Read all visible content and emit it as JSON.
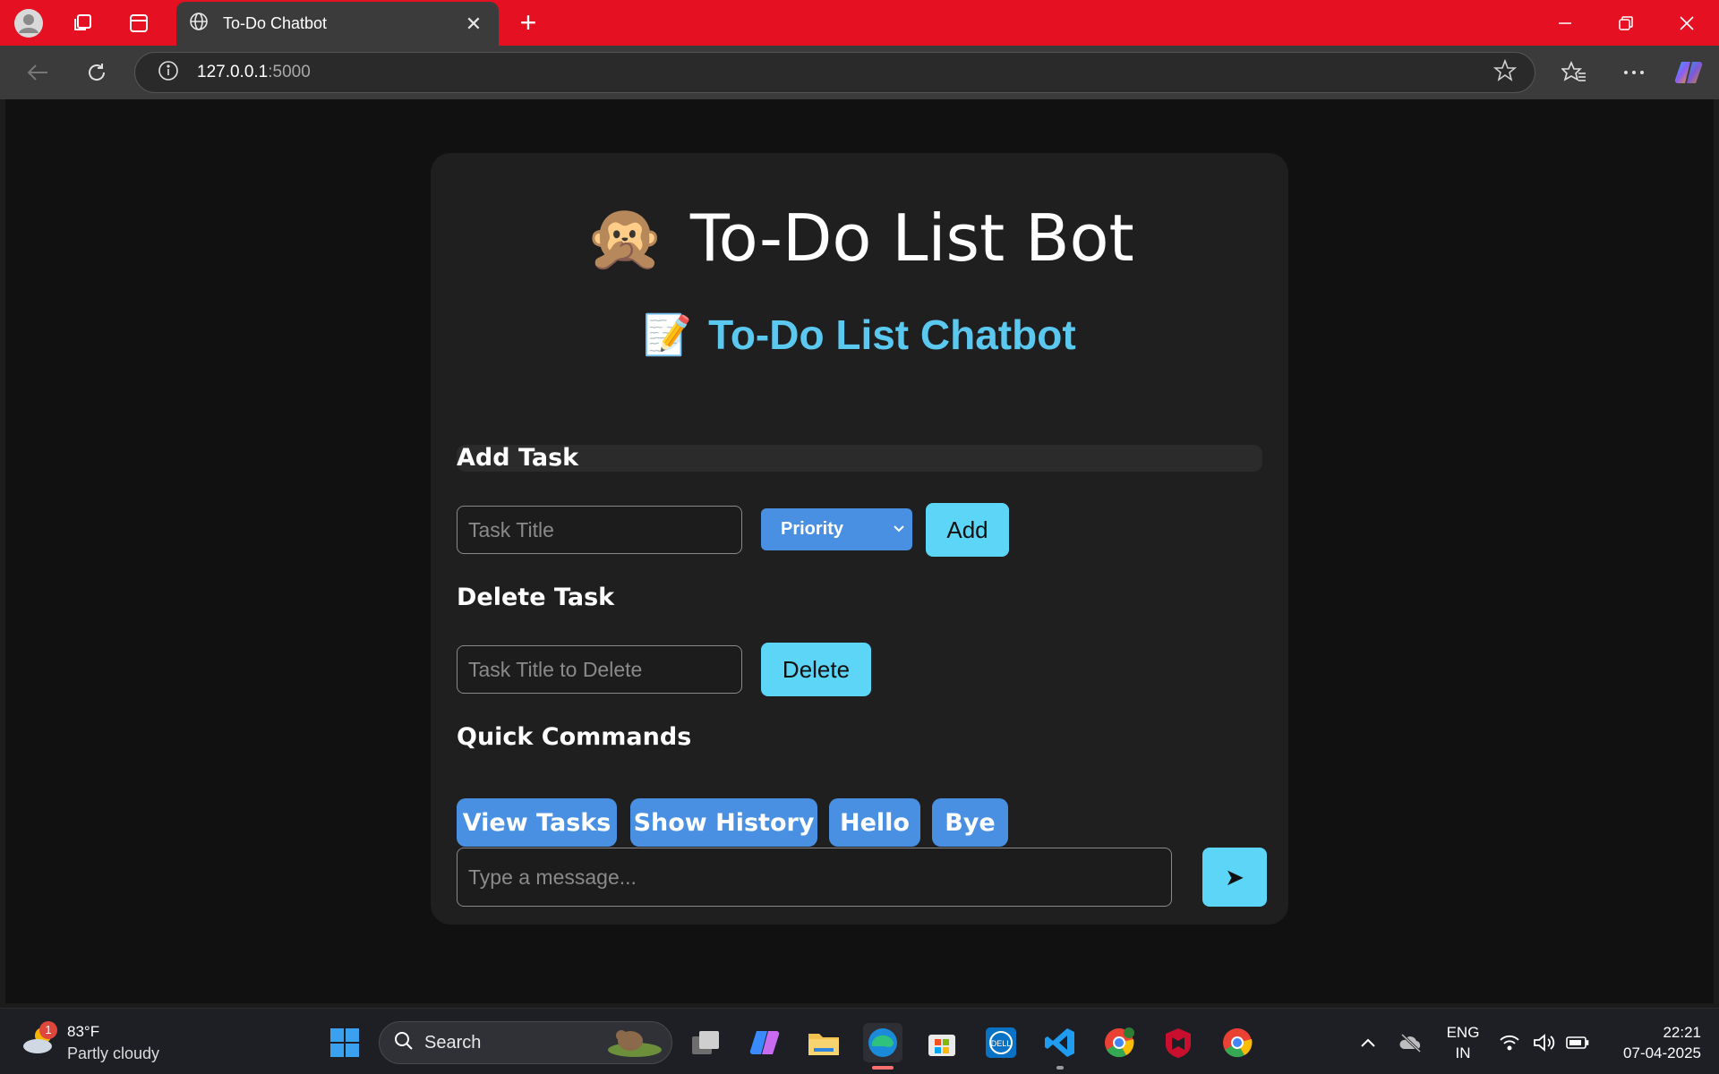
{
  "browser": {
    "tab_title": "To-Do Chatbot",
    "url_host": "127.0.0.1",
    "url_port": ":5000"
  },
  "app": {
    "title_emoji": "🙊",
    "title": "To-Do List Bot",
    "subtitle_emoji": "📝",
    "subtitle": "To-Do List Chatbot",
    "add_task": {
      "heading": "Add Task",
      "input_placeholder": "Task Title",
      "priority_label": "Priority",
      "button_label": "Add"
    },
    "delete_task": {
      "heading": "Delete Task",
      "input_placeholder": "Task Title to Delete",
      "button_label": "Delete"
    },
    "quick_commands": {
      "heading": "Quick Commands",
      "buttons": [
        "View Tasks",
        "Show History",
        "Hello",
        "Bye"
      ]
    },
    "message": {
      "placeholder": "Type a message...",
      "send_glyph": "➤"
    }
  },
  "taskbar": {
    "weather_temp": "83°F",
    "weather_desc": "Partly cloudy",
    "weather_badge": "1",
    "search_label": "Search",
    "language_top": "ENG",
    "language_bottom": "IN",
    "time": "22:21",
    "date": "07-04-2025"
  },
  "colors": {
    "titlebar": "#e51123",
    "accent_cyan": "#5dd5f7",
    "accent_blue": "#4a90e2",
    "subtitle": "#5bc8f0"
  }
}
